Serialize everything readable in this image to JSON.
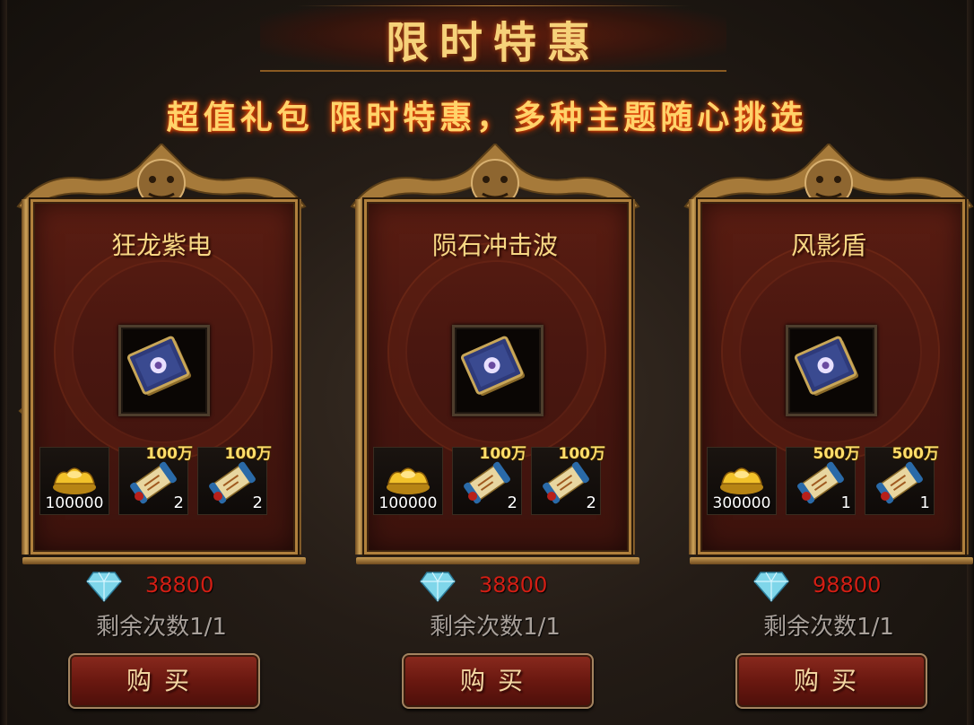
{
  "header": {
    "title": "限时特惠",
    "subtitle": "超值礼包 限时特惠，多种主题随心挑选"
  },
  "nav": {
    "prev_icon": "chevron-left-icon"
  },
  "currency_icon": "diamond-icon",
  "colors": {
    "title_gold": "#f6d27a",
    "price_red": "#d21e14",
    "panel_red": "#4a1710",
    "frame_gold": "#b0803c"
  },
  "packs": [
    {
      "name": "狂龙紫电",
      "main_item_icon": "skill-book-icon",
      "items": [
        {
          "icon": "gold-ingot-icon",
          "count": "100000",
          "tag": ""
        },
        {
          "icon": "scroll-icon",
          "count": "2",
          "tag": "100万"
        },
        {
          "icon": "scroll-icon",
          "count": "2",
          "tag": "100万"
        }
      ],
      "price": "38800",
      "remaining": "剩余次数1/1",
      "buy_label": "购买"
    },
    {
      "name": "陨石冲击波",
      "main_item_icon": "skill-book-icon",
      "items": [
        {
          "icon": "gold-ingot-icon",
          "count": "100000",
          "tag": ""
        },
        {
          "icon": "scroll-icon",
          "count": "2",
          "tag": "100万"
        },
        {
          "icon": "scroll-icon",
          "count": "2",
          "tag": "100万"
        }
      ],
      "price": "38800",
      "remaining": "剩余次数1/1",
      "buy_label": "购买"
    },
    {
      "name": "风影盾",
      "main_item_icon": "skill-book-icon",
      "items": [
        {
          "icon": "gold-ingot-icon",
          "count": "300000",
          "tag": ""
        },
        {
          "icon": "scroll-icon",
          "count": "1",
          "tag": "500万"
        },
        {
          "icon": "scroll-icon",
          "count": "1",
          "tag": "500万"
        }
      ],
      "price": "98800",
      "remaining": "剩余次数1/1",
      "buy_label": "购买"
    }
  ]
}
